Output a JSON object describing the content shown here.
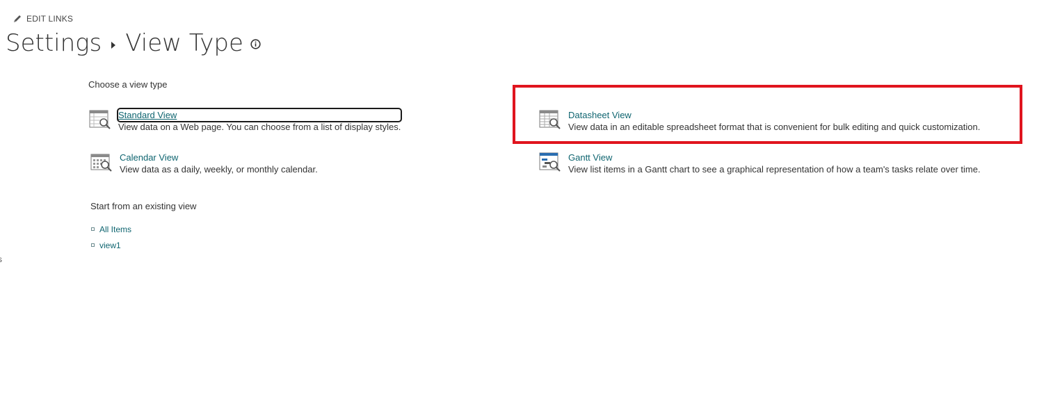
{
  "header": {
    "edit_links_label": "EDIT LINKS",
    "breadcrumb": [
      "Settings",
      "View Type"
    ]
  },
  "choose_section": {
    "label": "Choose a view type",
    "views": [
      {
        "name": "Standard View",
        "description": "View data on a Web page. You can choose from a list of display styles.",
        "icon": "standard-view-icon"
      },
      {
        "name": "Datasheet View",
        "description": "View data in an editable spreadsheet format that is convenient for bulk editing and quick customization.",
        "icon": "datasheet-view-icon"
      },
      {
        "name": "Calendar View",
        "description": "View data as a daily, weekly, or monthly calendar.",
        "icon": "calendar-view-icon"
      },
      {
        "name": "Gantt View",
        "description": "View list items in a Gantt chart to see a graphical representation of how a team's tasks relate over time.",
        "icon": "gantt-view-icon"
      }
    ]
  },
  "existing_section": {
    "label": "Start from an existing view",
    "views": [
      "All Items",
      "view1"
    ]
  },
  "edge_glyph": "s",
  "colors": {
    "link": "#0f6570",
    "highlight": "#e0141e",
    "text": "#333333"
  }
}
